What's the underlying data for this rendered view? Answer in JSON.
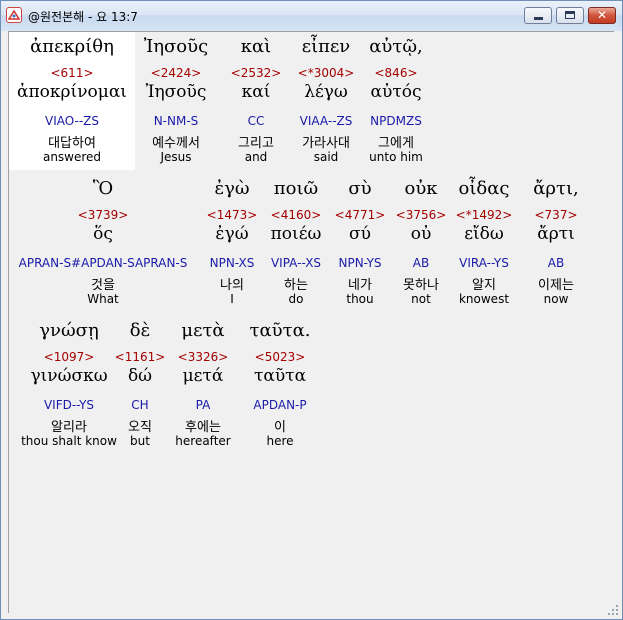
{
  "window": {
    "title": "@원전본해 - 요 13:7",
    "buttons": {
      "minimize": "minimize",
      "maximize": "maximize",
      "close": "✕"
    }
  },
  "rows": [
    {
      "words": [
        {
          "greek": "ἀπεκρίθη",
          "strong": "<611>",
          "lemma": "ἀποκρίνομαι",
          "morph": "VIAO--ZS",
          "korean": "대답하여",
          "english": "answered"
        },
        {
          "greek": "Ἰησοῦς",
          "strong": "<2424>",
          "lemma": "Ἰησοῦς",
          "morph": "N-NM-S",
          "korean": "예수께서",
          "english": "Jesus"
        },
        {
          "greek": "καὶ",
          "strong": "<2532>",
          "lemma": "καί",
          "morph": "CC",
          "korean": "그리고",
          "english": "and"
        },
        {
          "greek": "εἶπεν",
          "strong": "<*3004>",
          "lemma": "λέγω",
          "morph": "VIAA--ZS",
          "korean": "가라사대",
          "english": "said"
        },
        {
          "greek": "αὐτῷ,",
          "strong": "<846>",
          "lemma": "αὐτός",
          "morph": "NPDMZS",
          "korean": "그에게",
          "english": "unto him"
        }
      ]
    },
    {
      "words": [
        {
          "greek": "Ὃ",
          "strong": "<3739>",
          "lemma": "ὅς",
          "morph": "APRAN-S#APDAN-SAPRAN-S",
          "korean": "것을",
          "english": "What"
        },
        {
          "greek": "ἐγὼ",
          "strong": "<1473>",
          "lemma": "ἐγώ",
          "morph": "NPN-XS",
          "korean": "나의",
          "english": "I"
        },
        {
          "greek": "ποιῶ",
          "strong": "<4160>",
          "lemma": "ποιέω",
          "morph": "VIPA--XS",
          "korean": "하는",
          "english": "do"
        },
        {
          "greek": "σὺ",
          "strong": "<4771>",
          "lemma": "σύ",
          "morph": "NPN-YS",
          "korean": "네가",
          "english": "thou"
        },
        {
          "greek": "οὐκ",
          "strong": "<3756>",
          "lemma": "οὐ",
          "morph": "AB",
          "korean": "못하나",
          "english": "not"
        },
        {
          "greek": "οἶδας",
          "strong": "<*1492>",
          "lemma": "εἴδω",
          "morph": "VIRA--YS",
          "korean": "알지",
          "english": "knowest"
        },
        {
          "greek": "ἄρτι,",
          "strong": "<737>",
          "lemma": "ἄρτι",
          "morph": "AB",
          "korean": "이제는",
          "english": "now"
        }
      ]
    },
    {
      "words": [
        {
          "greek": "γνώσῃ",
          "strong": "<1097>",
          "lemma": "γινώσκω",
          "morph": "VIFD--YS",
          "korean": "알리라",
          "english": "thou shalt know"
        },
        {
          "greek": "δὲ",
          "strong": "<1161>",
          "lemma": "δώ",
          "morph": "CH",
          "korean": "오직",
          "english": "but"
        },
        {
          "greek": "μετὰ",
          "strong": "<3326>",
          "lemma": "μετά",
          "morph": "PA",
          "korean": "후에는",
          "english": "hereafter"
        },
        {
          "greek": "ταῦτα.",
          "strong": "<5023>",
          "lemma": "ταῦτα",
          "morph": "APDAN-P",
          "korean": "이",
          "english": "here"
        }
      ]
    }
  ]
}
